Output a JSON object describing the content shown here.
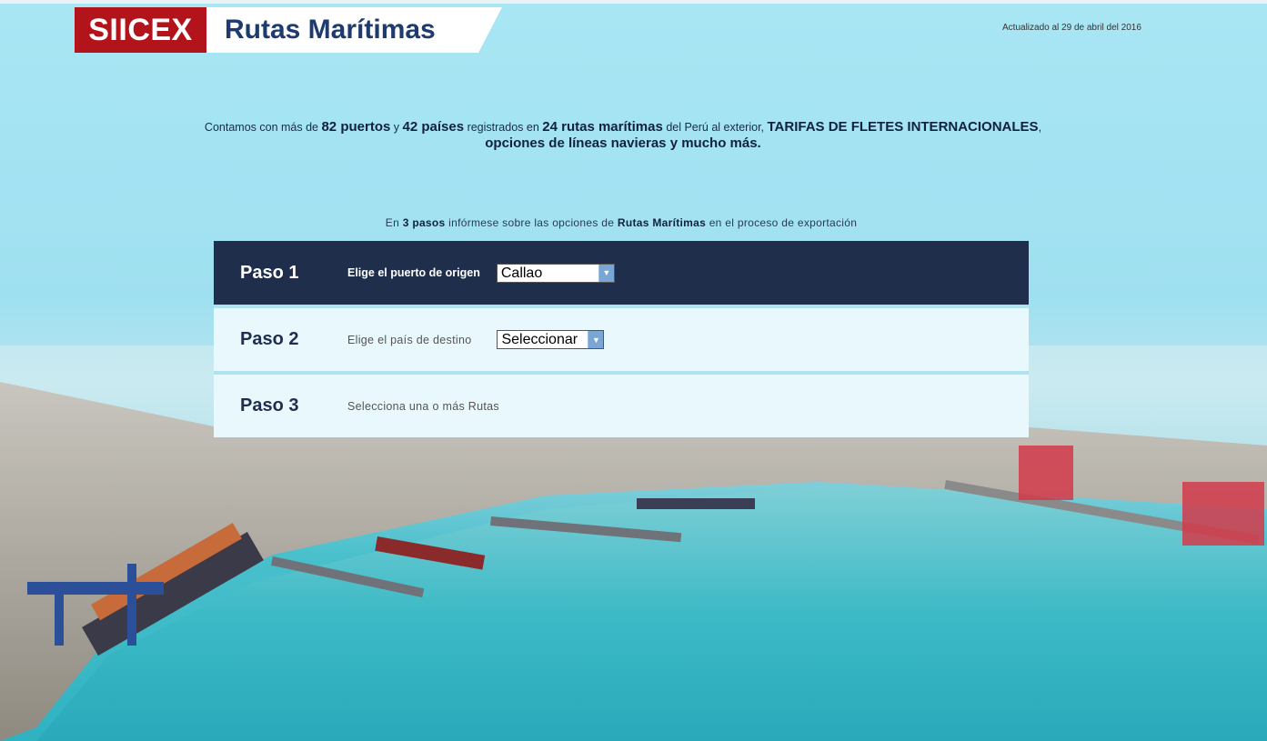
{
  "header": {
    "brand": "SIICEX",
    "product": "Rutas Marítimas",
    "updated": "Actualizado al 29 de abril del 2016"
  },
  "intro": {
    "t1": "Contamos con más de ",
    "ports": "82 puertos",
    "t2": " y ",
    "countries": "42 países",
    "t3": " registrados en ",
    "routes": "24 rutas marítimas",
    "t4": " del Perú al exterior, ",
    "tariffs": "TARIFAS DE FLETES INTERNACIONALES",
    "t5": ", ",
    "options": "opciones de líneas navieras y mucho más."
  },
  "steps_intro": {
    "t1": "En ",
    "steps": "3 pasos",
    "t2": " infórmese sobre las opciones de ",
    "rutas": "Rutas Marítimas",
    "t3": " en el proceso de exportación"
  },
  "steps": [
    {
      "title": "Paso 1",
      "label": "Elige el puerto de origen",
      "select_value": "Callao"
    },
    {
      "title": "Paso 2",
      "label": "Elige el país de destino",
      "select_value": "Seleccionar"
    },
    {
      "title": "Paso 3",
      "label": "Selecciona una o más Rutas"
    }
  ],
  "colors": {
    "brand_red": "#b3141c",
    "navy": "#1f2e4b",
    "step_bg": "#e8f8fc"
  }
}
